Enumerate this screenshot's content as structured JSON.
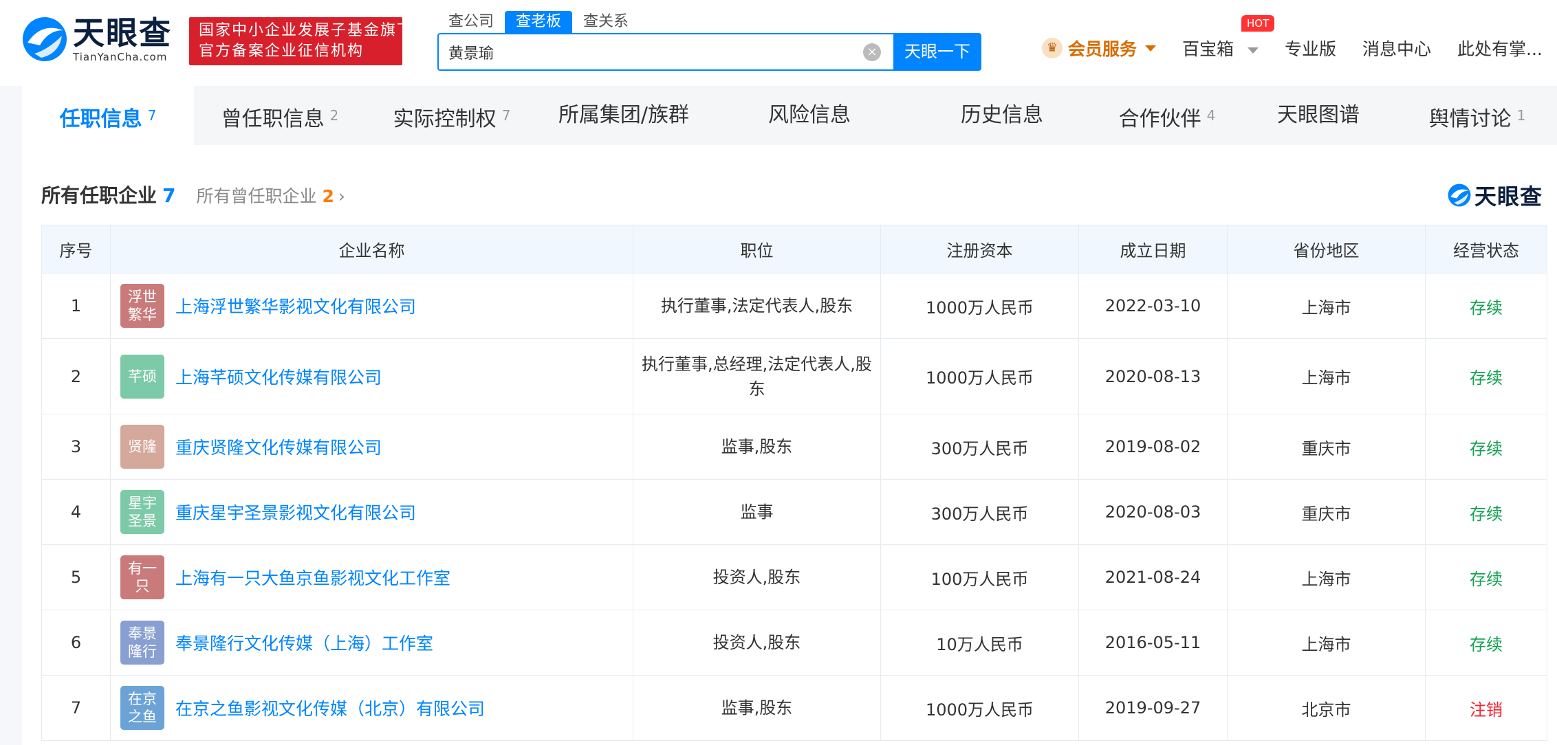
{
  "logo": {
    "name": "天眼查",
    "url": "TianYanCha.com"
  },
  "badge": {
    "line1": "国家中小企业发展子基金旗下",
    "line2": "官方备案企业征信机构"
  },
  "search": {
    "tabs": [
      "查公司",
      "查老板",
      "查关系"
    ],
    "active_tab": 1,
    "value": "黄景瑜",
    "button_label": "天眼一下"
  },
  "nav": {
    "vip_label": "会员服务",
    "toolbox_label": "百宝箱",
    "hot_label": "HOT",
    "pro_label": "专业版",
    "messages_label": "消息中心",
    "owner_label": "此处有掌..."
  },
  "tabs": [
    {
      "label": "任职信息",
      "count": "7"
    },
    {
      "label": "曾任职信息",
      "count": "2"
    },
    {
      "label": "实际控制权",
      "count": "7"
    },
    {
      "label": "所属集团/族群",
      "count": ""
    },
    {
      "label": "风险信息",
      "count": ""
    },
    {
      "label": "历史信息",
      "count": ""
    },
    {
      "label": "合作伙伴",
      "count": "4"
    },
    {
      "label": "天眼图谱",
      "count": ""
    },
    {
      "label": "舆情讨论",
      "count": "1"
    }
  ],
  "section": {
    "title": "所有任职企业",
    "count": "7",
    "link_label": "所有曾任职企业",
    "link_count": "2"
  },
  "watermark": "天眼查",
  "table": {
    "headers": [
      "序号",
      "企业名称",
      "职位",
      "注册资本",
      "成立日期",
      "省份地区",
      "经营状态"
    ],
    "rows": [
      {
        "no": "1",
        "avatar": "浮世繁华",
        "avatar_color": "#c97b7b",
        "name": "上海浮世繁华影视文化有限公司",
        "position": "执行董事,法定代表人,股东",
        "capital": "1000万人民币",
        "date": "2022-03-10",
        "region": "上海市",
        "status": "存续",
        "status_type": "ok"
      },
      {
        "no": "2",
        "avatar": "芊硕",
        "avatar_color": "#7ccaa7",
        "name": "上海芊硕文化传媒有限公司",
        "position": "执行董事,总经理,法定代表人,股东",
        "capital": "1000万人民币",
        "date": "2020-08-13",
        "region": "上海市",
        "status": "存续",
        "status_type": "ok"
      },
      {
        "no": "3",
        "avatar": "贤隆",
        "avatar_color": "#d4a89a",
        "name": "重庆贤隆文化传媒有限公司",
        "position": "监事,股东",
        "capital": "300万人民币",
        "date": "2019-08-02",
        "region": "重庆市",
        "status": "存续",
        "status_type": "ok"
      },
      {
        "no": "4",
        "avatar": "星宇圣景",
        "avatar_color": "#7ccaa7",
        "name": "重庆星宇圣景影视文化有限公司",
        "position": "监事",
        "capital": "300万人民币",
        "date": "2020-08-03",
        "region": "重庆市",
        "status": "存续",
        "status_type": "ok"
      },
      {
        "no": "5",
        "avatar": "有一只",
        "avatar_color": "#c97b7b",
        "name": "上海有一只大鱼京鱼影视文化工作室",
        "position": "投资人,股东",
        "capital": "100万人民币",
        "date": "2021-08-24",
        "region": "上海市",
        "status": "存续",
        "status_type": "ok"
      },
      {
        "no": "6",
        "avatar": "奉景隆行",
        "avatar_color": "#8a9fd1",
        "name": "奉景隆行文化传媒（上海）工作室",
        "position": "投资人,股东",
        "capital": "10万人民币",
        "date": "2016-05-11",
        "region": "上海市",
        "status": "存续",
        "status_type": "ok"
      },
      {
        "no": "7",
        "avatar": "在京之鱼",
        "avatar_color": "#6ba3d6",
        "name": "在京之鱼影视文化传媒（北京）有限公司",
        "position": "监事,股东",
        "capital": "1000万人民币",
        "date": "2019-09-27",
        "region": "北京市",
        "status": "注销",
        "status_type": "bad"
      }
    ]
  },
  "colors": {
    "accent": "#0084ff",
    "status_ok": "#12a151",
    "status_bad": "#f5222d",
    "badge_red": "#d7202b"
  }
}
